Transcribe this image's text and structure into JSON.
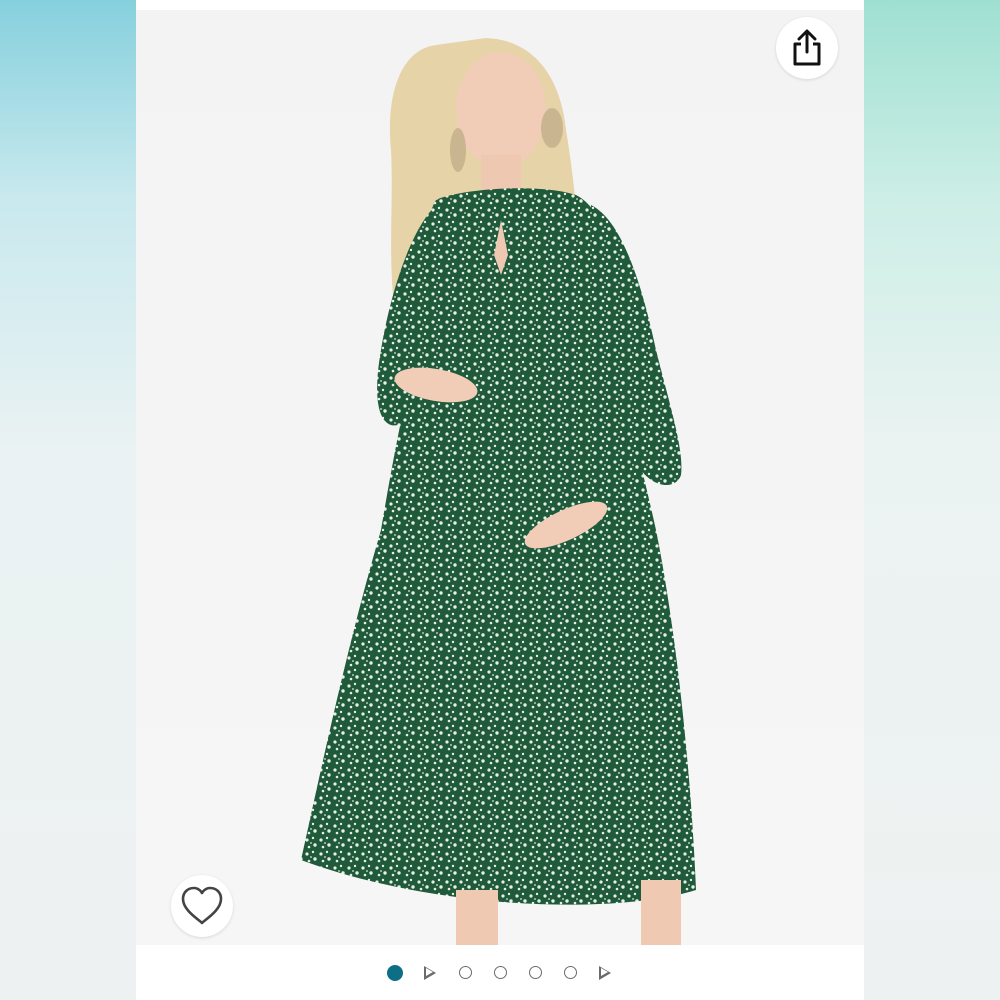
{
  "product_image": {
    "description_icon": "dress-photo",
    "dress_color": "#1f5a3a",
    "dress_print_color": "#e9eee6"
  },
  "actions": {
    "share_icon": "share-icon",
    "wishlist_icon": "heart-icon"
  },
  "pager": {
    "active_index": 0,
    "items": [
      {
        "type": "image",
        "active": true
      },
      {
        "type": "video",
        "active": false
      },
      {
        "type": "image",
        "active": false
      },
      {
        "type": "image",
        "active": false
      },
      {
        "type": "image",
        "active": false
      },
      {
        "type": "image",
        "active": false
      },
      {
        "type": "video",
        "active": false
      }
    ],
    "active_color": "#0e6e86"
  }
}
